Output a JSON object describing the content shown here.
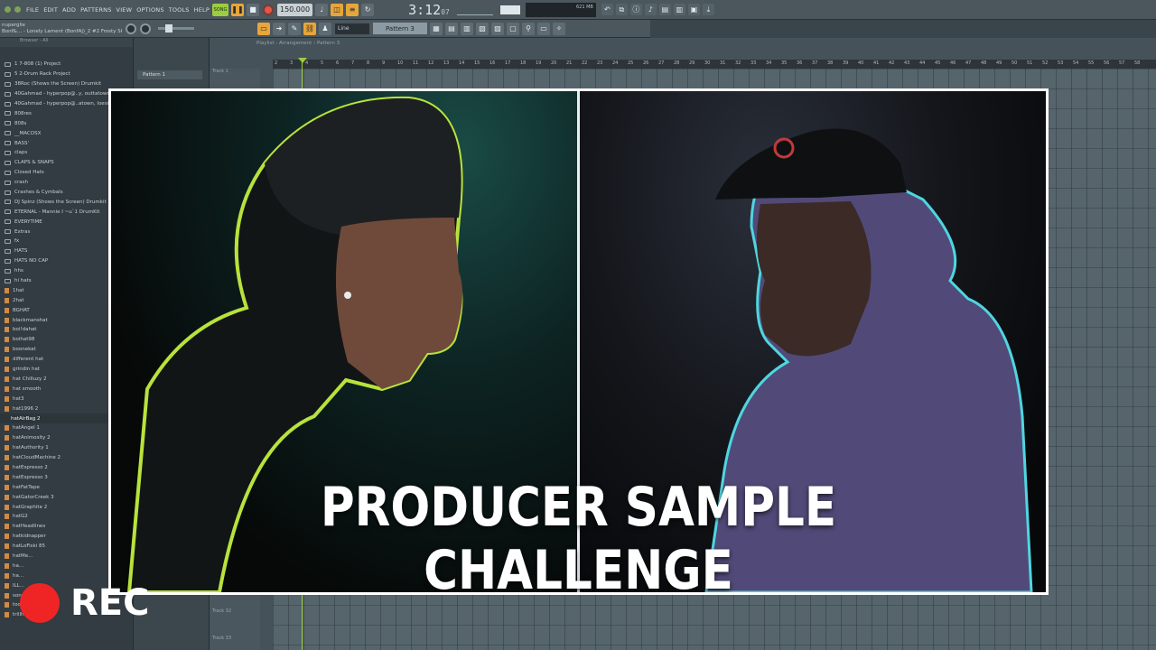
{
  "toolbar": {
    "menu": [
      "FILE",
      "EDIT",
      "ADD",
      "PATTERNS",
      "VIEW",
      "OPTIONS",
      "TOOLS",
      "HELP"
    ],
    "song_mode": "SONG",
    "tempo": "150.000",
    "time": "3:12",
    "time_sub": "07",
    "cpu_text": "621 MB",
    "snap": "Line",
    "pattern": "Pattern 3",
    "hint_line1": "nuperglie",
    "hint_line2": "Bonf&... - Lonely Lament (BonfAj)_2 #2  Frosty Skies"
  },
  "browser": {
    "header": "Browser - All",
    "items": [
      {
        "label": "1 7-808 (1) Project",
        "kind": "folder"
      },
      {
        "label": "5 2-Drum Rack Project",
        "kind": "folder"
      },
      {
        "label": "38Roc (Shows the Screen) Drumkit",
        "kind": "folder"
      },
      {
        "label": "40Gahmad - hyperpop@..y, outtatown",
        "kind": "folder"
      },
      {
        "label": "40Gahmad - hyperpop@..atown, loesi",
        "kind": "folder"
      },
      {
        "label": "808res",
        "kind": "folder"
      },
      {
        "label": "808s",
        "kind": "folder"
      },
      {
        "label": "__MACOSX",
        "kind": "folder"
      },
      {
        "label": "BASS'",
        "kind": "folder"
      },
      {
        "label": "claps",
        "kind": "folder"
      },
      {
        "label": "CLAPS & SNAPS",
        "kind": "folder"
      },
      {
        "label": "Closed Hats",
        "kind": "folder"
      },
      {
        "label": "crash",
        "kind": "folder"
      },
      {
        "label": "Crashes & Cymbals",
        "kind": "folder"
      },
      {
        "label": "DJ Spinz (Shows the Screen) Drumkit",
        "kind": "folder"
      },
      {
        "label": "ETERNAL - Mannie I ~u`1 DrumKit",
        "kind": "folder"
      },
      {
        "label": "EVERYTIME",
        "kind": "folder"
      },
      {
        "label": "Extras",
        "kind": "folder"
      },
      {
        "label": "fx",
        "kind": "folder"
      },
      {
        "label": "HATS",
        "kind": "folder"
      },
      {
        "label": "HATS NO CAP",
        "kind": "folder"
      },
      {
        "label": "hhs",
        "kind": "folder"
      },
      {
        "label": "hi hats",
        "kind": "folder"
      },
      {
        "label": "1hat",
        "kind": "file"
      },
      {
        "label": "2hat",
        "kind": "file"
      },
      {
        "label": "BGHAT",
        "kind": "file"
      },
      {
        "label": "blackmanshat",
        "kind": "file"
      },
      {
        "label": "boi!dahat",
        "kind": "file"
      },
      {
        "label": "boihat98",
        "kind": "file"
      },
      {
        "label": "boonekat",
        "kind": "file"
      },
      {
        "label": "different hat",
        "kind": "file"
      },
      {
        "label": "grindin hat",
        "kind": "file"
      },
      {
        "label": "hat Chilluzy 2",
        "kind": "file"
      },
      {
        "label": "hat smooth",
        "kind": "file"
      },
      {
        "label": "hat3",
        "kind": "file"
      },
      {
        "label": "hat1996 2",
        "kind": "file"
      },
      {
        "label": "hatAirBag 2",
        "kind": "selected"
      },
      {
        "label": "hatAngel 1",
        "kind": "file"
      },
      {
        "label": "hatAnimosity 2",
        "kind": "file"
      },
      {
        "label": "hatAuthority 1",
        "kind": "file"
      },
      {
        "label": "hatCloudMachine 2",
        "kind": "file"
      },
      {
        "label": "hatEspresso 2",
        "kind": "file"
      },
      {
        "label": "hatEspresso 3",
        "kind": "file"
      },
      {
        "label": "hatFatTape",
        "kind": "file"
      },
      {
        "label": "hatGatorCreek 3",
        "kind": "file"
      },
      {
        "label": "hatGraphite 2",
        "kind": "file"
      },
      {
        "label": "hatG2",
        "kind": "file"
      },
      {
        "label": "hatHeadlines",
        "kind": "file"
      },
      {
        "label": "hatkidnapper",
        "kind": "file"
      },
      {
        "label": "hatLoFiski 85",
        "kind": "file"
      },
      {
        "label": "hatMe...",
        "kind": "file"
      },
      {
        "label": "ha...",
        "kind": "file"
      },
      {
        "label": "ha...",
        "kind": "file"
      },
      {
        "label": "ILL...",
        "kind": "file"
      },
      {
        "label": "sonydhat",
        "kind": "file"
      },
      {
        "label": "toomuch hat",
        "kind": "file"
      },
      {
        "label": "trillhat",
        "kind": "file"
      }
    ]
  },
  "pattern_column": {
    "pattern_item": "Pattern 1"
  },
  "playlist": {
    "header": "Playlist - Arrangement › Pattern 3",
    "ruler": [
      "2",
      "3",
      "4",
      "5",
      "6",
      "7",
      "8",
      "9",
      "10",
      "11",
      "12",
      "13",
      "14",
      "15",
      "16",
      "17",
      "18",
      "19",
      "20",
      "21",
      "22",
      "23",
      "24",
      "25",
      "26",
      "27",
      "28",
      "29",
      "30",
      "31",
      "32",
      "33",
      "34",
      "35",
      "36",
      "37",
      "38",
      "39",
      "40",
      "41",
      "42",
      "43",
      "44",
      "45",
      "46",
      "47",
      "48",
      "49",
      "50",
      "51",
      "52",
      "53",
      "54",
      "55",
      "56",
      "57",
      "58"
    ],
    "track_top": "Track 1",
    "track_32": "Track 32",
    "track_33": "Track 33"
  },
  "overlay": {
    "title": "PRODUCER SAMPLE CHALLENGE",
    "rec_label": "REC"
  }
}
